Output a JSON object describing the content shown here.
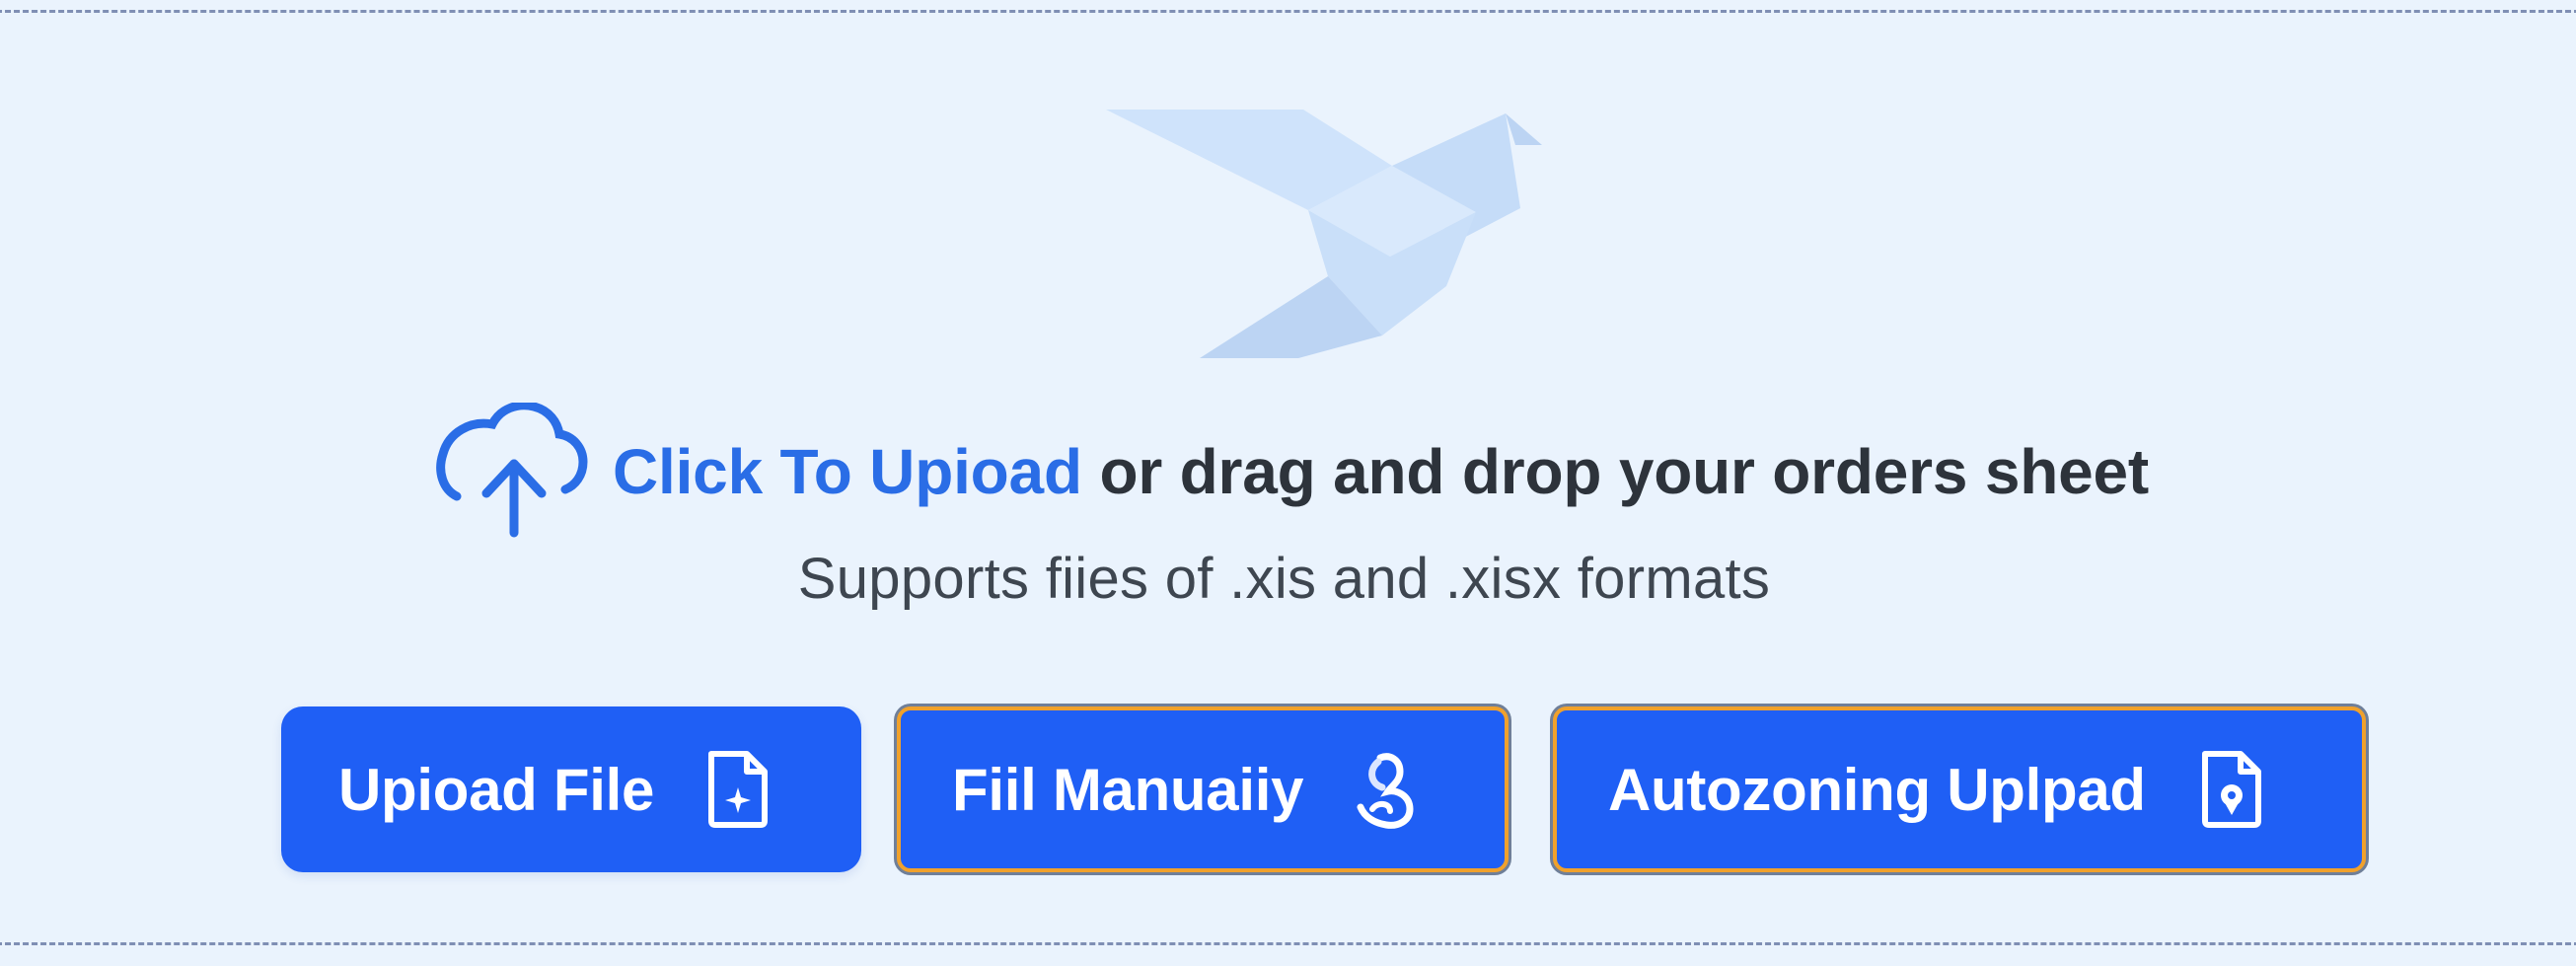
{
  "upload_area": {
    "illustration": "origami-bird",
    "cloud_icon": "cloud-upload-icon",
    "link_text": "Click To Upioad",
    "instruction_text": " or drag and drop your orders sheet",
    "supported_formats": "Supports fiies of .xis and .xisx formats"
  },
  "buttons": {
    "upload_file": {
      "label": "Upioad File",
      "icon": "file-plus-icon"
    },
    "fill_manually": {
      "label": "Fiil Manuaiiy",
      "icon": "hand-pointer-icon"
    },
    "autozoning_upload": {
      "label": "Autozoning Uplpad",
      "icon": "file-pin-icon"
    }
  },
  "colors": {
    "accent": "#2a6de6",
    "button_bg": "#1f5ff5",
    "focus_outline": "#f0a12c",
    "background": "#eaf3fd",
    "heading_text": "#2d333b"
  }
}
